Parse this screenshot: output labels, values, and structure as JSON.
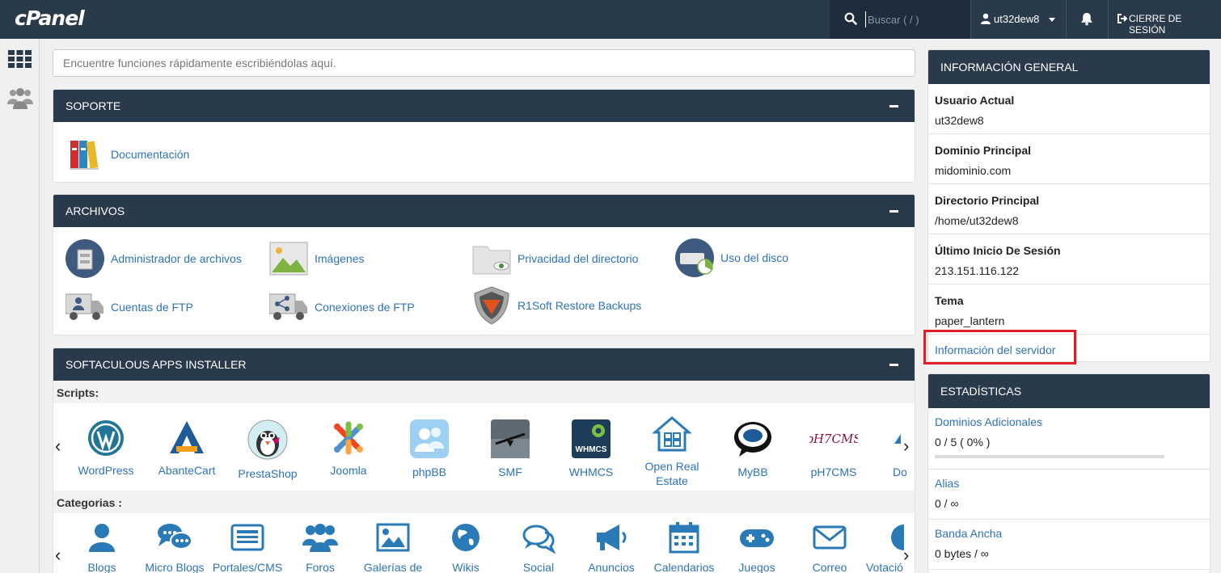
{
  "header": {
    "logo": "cPanel",
    "search_placeholder": "Buscar ( / )",
    "username": "ut32dew8",
    "logout": "CIERRE DE SESIÓN"
  },
  "quick_find_placeholder": "Encuentre funciones rápidamente escribiéndolas aquí.",
  "soporte": {
    "title": "SOPORTE",
    "items": [
      "Documentación"
    ]
  },
  "archivos": {
    "title": "ARCHIVOS",
    "items": [
      "Administrador de archivos",
      "Imágenes",
      "Privacidad del directorio",
      "Uso del disco",
      "Cuentas de FTP",
      "Conexiones de FTP",
      "R1Soft Restore Backups"
    ]
  },
  "softaculous": {
    "title": "SOFTACULOUS APPS INSTALLER",
    "scripts_label": "Scripts:",
    "scripts": [
      "WordPress",
      "AbanteCart",
      "PrestaShop",
      "Joomla",
      "phpBB",
      "SMF",
      "WHMCS",
      "Open Real Estate",
      "MyBB",
      "pH7CMS",
      "Do"
    ],
    "categories_label": "Categorias :",
    "categories": [
      "Blogs",
      "Micro Blogs",
      "Portales/CMS",
      "Foros",
      "Galerías de",
      "Wikis",
      "Social",
      "Anuncios",
      "Calendarios",
      "Juegos",
      "Correo",
      "Votació"
    ],
    "prev": "‹",
    "next": "›",
    "icon_texts": {
      "whmcs": "WHMCS",
      "ph7cms": "pH7CMS"
    }
  },
  "general_info": {
    "title": "INFORMACIÓN GENERAL",
    "rows": [
      {
        "label": "Usuario Actual",
        "value": "ut32dew8"
      },
      {
        "label": "Dominio Principal",
        "value": "midominio.com"
      },
      {
        "label": "Directorio Principal",
        "value": "/home/ut32dew8"
      },
      {
        "label": "Último Inicio De Sesión",
        "value": "213.151.116.122"
      },
      {
        "label": "Tema",
        "value": "paper_lantern"
      }
    ],
    "server_info_link": "Información del servidor"
  },
  "stats": {
    "title": "ESTADÍSTICAS",
    "rows": [
      {
        "label": "Dominios Adicionales",
        "value": "0 / 5 ( 0% )",
        "usage_fraction": 0
      },
      {
        "label": "Alias",
        "value": "0 / ∞"
      },
      {
        "label": "Banda Ancha",
        "value": "0 bytes / ∞"
      }
    ]
  },
  "colors": {
    "header": "#293a4a",
    "link": "#2e73b6",
    "highlight": "#e21b24"
  }
}
